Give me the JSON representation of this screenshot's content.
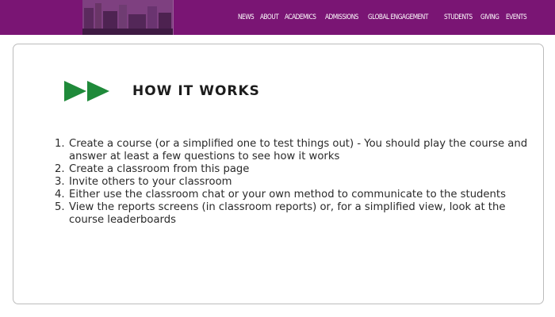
{
  "nav": {
    "items": [
      "NEWS",
      "ABOUT",
      "ACADEMICS",
      "ADMISSIONS",
      "GLOBAL ENGAGEMENT",
      "STUDENTS",
      "GIVING",
      "EVENTS"
    ]
  },
  "main": {
    "heading": "HOW IT WORKS",
    "steps": [
      {
        "num": "1.",
        "text": "Create a course (or a simplified one to test things out) - You should play the course and answer at least a few questions to see how it works"
      },
      {
        "num": "2.",
        "text": "Create a classroom from this page"
      },
      {
        "num": "3.",
        "text": "Invite others to your classroom"
      },
      {
        "num": "4.",
        "text": "Either use the classroom chat or your own method to communicate to the students"
      },
      {
        "num": "5.",
        "text": "View the reports screens (in classroom reports) or, for a simplified view, look at the course leaderboards"
      }
    ]
  },
  "colors": {
    "header_bg": "#7a1574",
    "accent_green": "#1f8a3a",
    "text": "#2a2a2a"
  },
  "icons": {
    "heading_icon": "fast-forward-icon"
  }
}
